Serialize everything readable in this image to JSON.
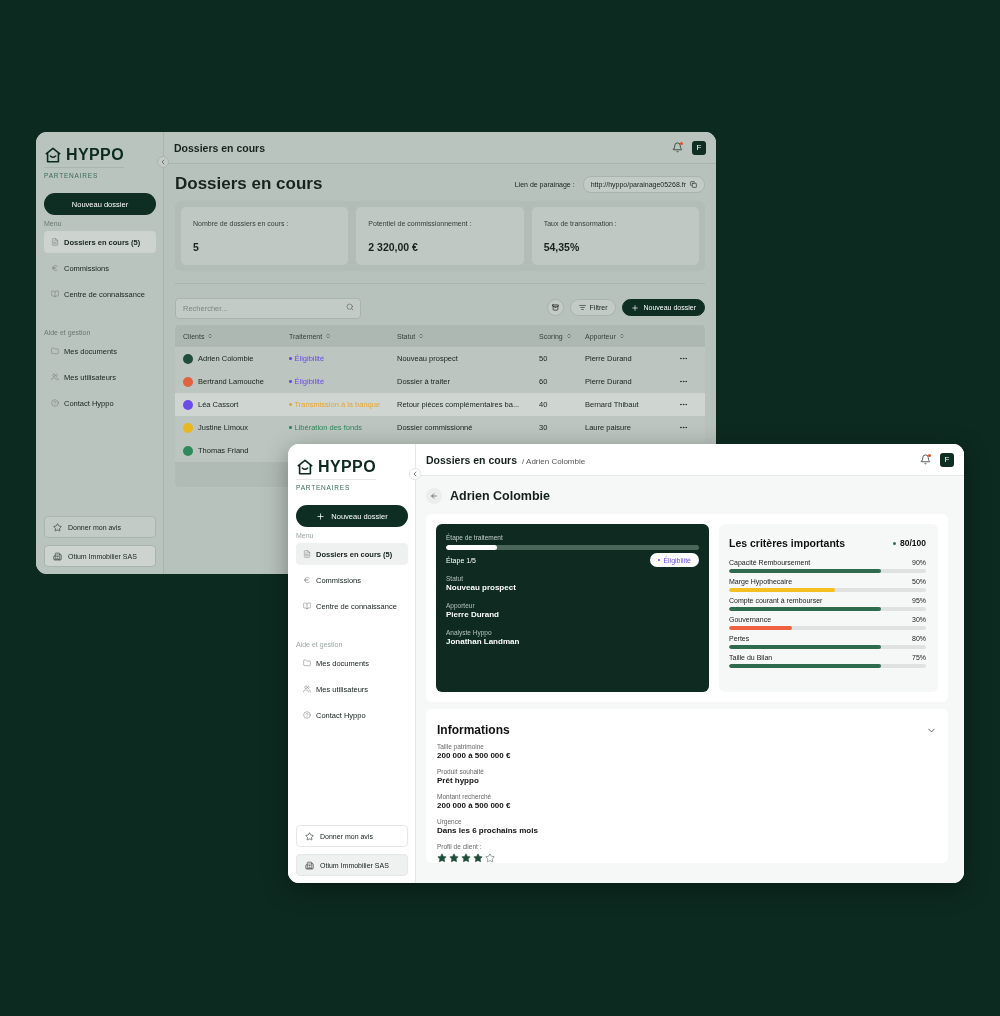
{
  "back_window": {
    "sidebar": {
      "logo": "HYPPO",
      "tagline": "PARTENAIRES",
      "new_button": {
        "label": "Nouveau dossier",
        "plus": false
      },
      "sections": [
        {
          "title": "Menu",
          "items": [
            {
              "label": "Dossiers en cours (5)",
              "selected": true
            },
            {
              "label": "Commissions",
              "selected": false
            },
            {
              "label": "Centre de connaissance",
              "selected": false
            }
          ]
        },
        {
          "title": "Aide et gestion",
          "items": [
            {
              "label": "Mes documents",
              "selected": false
            },
            {
              "label": "Mes utilisateurs",
              "selected": false
            },
            {
              "label": "Contact Hyppo",
              "selected": false
            }
          ]
        }
      ],
      "feedback": "Donner mon avis",
      "company": "Otium Immobilier SAS"
    },
    "header": {
      "title": "Dossiers en cours",
      "avatar": "F"
    },
    "page_title": "Dossiers en cours",
    "referral": {
      "label": "Lien de parainage :",
      "value": "http://hyppo/parainage05268.fr"
    },
    "stats": [
      {
        "label": "Nombre de dossiers en cours :",
        "value": "5"
      },
      {
        "label": "Potentiel de commissionnement :",
        "value": "2 320,00 €"
      },
      {
        "label": "Taux de transormation :",
        "value": "54,35%"
      }
    ],
    "search": {
      "placeholder": "Rechercher..."
    },
    "filter_button": "Filtrer",
    "new_button": "Nouveau dossier",
    "table": {
      "columns": [
        "Clients",
        "Traitement",
        "Statut",
        "Scoring",
        "Apporteur"
      ],
      "rows": [
        {
          "client": "Adrien Colombie",
          "avatar": {
            "color": "#1f4d3a"
          },
          "step": "Éligibilité",
          "color": "#6b4de6",
          "status": "Nouveau prospect",
          "scoring": "50",
          "referrer": "Pierre Durand",
          "selected": false
        },
        {
          "client": "Bertrand Lamouche",
          "avatar": {
            "color": "#e0623f"
          },
          "step": "Éligibilité",
          "color": "#6b4de6",
          "status": "Dossier à traiter",
          "scoring": "60",
          "referrer": "Pierre Durand",
          "selected": false
        },
        {
          "client": "Léa Cassort",
          "avatar": {
            "color": "#6b4de6"
          },
          "step": "Transmission à la banque",
          "color": "#e8a530",
          "status": "Retour pièces complémentaires ba...",
          "scoring": "40",
          "referrer": "Bernard Thibaut",
          "selected": true
        },
        {
          "client": "Justine Limoux",
          "avatar": {
            "color": "#e8b820"
          },
          "step": "Libération des fonds",
          "color": "#2e8a5a",
          "status": "Dossier commissionné",
          "scoring": "30",
          "referrer": "Laure paisure",
          "selected": false
        },
        {
          "client": "Thomas Friand",
          "avatar": {
            "color": "#2e8a5a"
          },
          "selected": false
        }
      ]
    }
  },
  "front_window": {
    "sidebar": {
      "logo": "HYPPO",
      "tagline": "PARTENAIRES",
      "new_button": {
        "label": "Nouveau dossier",
        "plus": true
      },
      "sections": [
        {
          "title": "Menu",
          "items": [
            {
              "label": "Dossiers en cours (5)",
              "selected": true
            },
            {
              "label": "Commissions",
              "selected": false
            },
            {
              "label": "Centre de connaissance",
              "selected": false
            }
          ]
        },
        {
          "title": "Aide et gestion",
          "items": [
            {
              "label": "Mes documents",
              "selected": false
            },
            {
              "label": "Mes utilisateurs",
              "selected": false
            },
            {
              "label": "Contact Hyppo",
              "selected": false
            }
          ]
        }
      ],
      "feedback": "Donner mon avis",
      "company": "Otium Immobilier SAS"
    },
    "header": {
      "title": "Dossiers en cours",
      "breadcrumb": "/ Adrien Colombie",
      "avatar": "F"
    },
    "client_name": "Adrien Colombie",
    "progress_card": {
      "label": "Étape de traitement",
      "level": 0.2,
      "step": "Étape 1/5",
      "badge": "Éligibilité",
      "fields": [
        {
          "label": "Statut",
          "value": "Nouveau prospect"
        },
        {
          "label": "Apporteur",
          "value": "Pierre Durand"
        },
        {
          "label": "Analyste Hyppo",
          "value": "Jonathan Landman"
        }
      ]
    },
    "criteria": {
      "title": "Les critères importants",
      "score": "80/100",
      "items": [
        {
          "label": "Capacité Remboursement",
          "value": "90%",
          "level": 0.77,
          "color": "#2e6b4f"
        },
        {
          "label": "Marge Hypothecaire",
          "value": "50%",
          "level": 0.54,
          "color": "#f5bf1f"
        },
        {
          "label": "Compte courant à rembourser",
          "value": "95%",
          "level": 0.77,
          "color": "#2e6b4f"
        },
        {
          "label": "Gouvernance",
          "value": "30%",
          "level": 0.32,
          "color": "#f0623f"
        },
        {
          "label": "Pertes",
          "value": "80%",
          "level": 0.77,
          "color": "#2e6b4f"
        },
        {
          "label": "Taille du Bilan",
          "value": "75%",
          "level": 0.77,
          "color": "#2e6b4f"
        }
      ]
    },
    "informations": {
      "title": "Informations",
      "fields": [
        {
          "label": "Taille patrimoine",
          "value": "200 000 à 500 000 €"
        },
        {
          "label": "Produit souhaité",
          "value": "Prêt hyppo"
        },
        {
          "label": "Montant recherché",
          "value": "200 000 à 500 000 €"
        },
        {
          "label": "Urgence",
          "value": "Dans les 6 prochains mois"
        }
      ],
      "profile_label": "Profil de client :",
      "stars": 4
    }
  }
}
